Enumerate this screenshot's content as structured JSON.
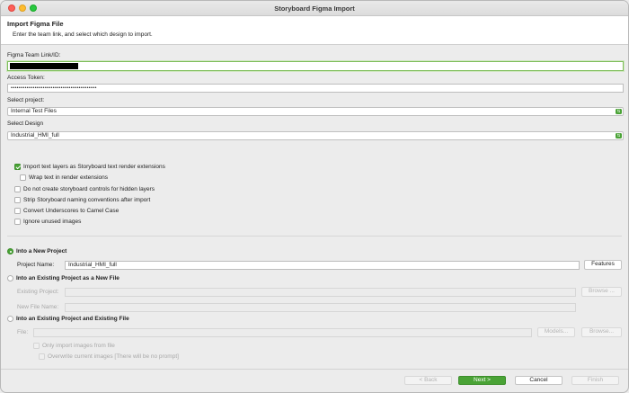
{
  "window": {
    "title": "Storyboard Figma Import"
  },
  "header": {
    "title": "Import Figma File",
    "subtitle": "Enter the team link, and select which design to import."
  },
  "team_link": {
    "label": "Figma Team Link/ID:",
    "value": ""
  },
  "access_token": {
    "label": "Access Token:",
    "value": "•••••••••••••••••••••••••••••••••••••••••••"
  },
  "project_select": {
    "label": "Select project:",
    "value": "Internal Test Files"
  },
  "design_select": {
    "label": "Select Design",
    "value": "Industrial_HMI_full"
  },
  "options": [
    {
      "label": "Import text layers as Storyboard text render extensions",
      "checked": true
    },
    {
      "label": "Wrap text in render extensions",
      "checked": false
    },
    {
      "label": "Do not create storyboard controls for hidden layers",
      "checked": false
    },
    {
      "label": "Strip Storyboard naming conventions after import",
      "checked": false
    },
    {
      "label": "Convert Underscores to Camel Case",
      "checked": false
    },
    {
      "label": "Ignore unused images",
      "checked": false
    }
  ],
  "new_project": {
    "label": "Into a New Project",
    "name_label": "Project Name:",
    "name_value": "Industrial_HMI_full",
    "features_button": "Features"
  },
  "existing_new_file": {
    "label": "Into an Existing Project as a New File",
    "existing_label": "Existing Project:",
    "browse_button": "Browse ...",
    "new_file_label": "New File Name:"
  },
  "existing_file": {
    "label": "Into an Existing Project and Existing File",
    "file_label": "File:",
    "models_button": "Models...",
    "browse_button": "Browse...",
    "only_import_label": "Only import images from file",
    "overwrite_label": "Overwrite current images [There will be no prompt]"
  },
  "footer": {
    "back": "< Back",
    "next": "Next >",
    "cancel": "Cancel",
    "finish": "Finish"
  },
  "colors": {
    "accent": "#4aa336",
    "focus_ring": "#7ebd5a"
  }
}
